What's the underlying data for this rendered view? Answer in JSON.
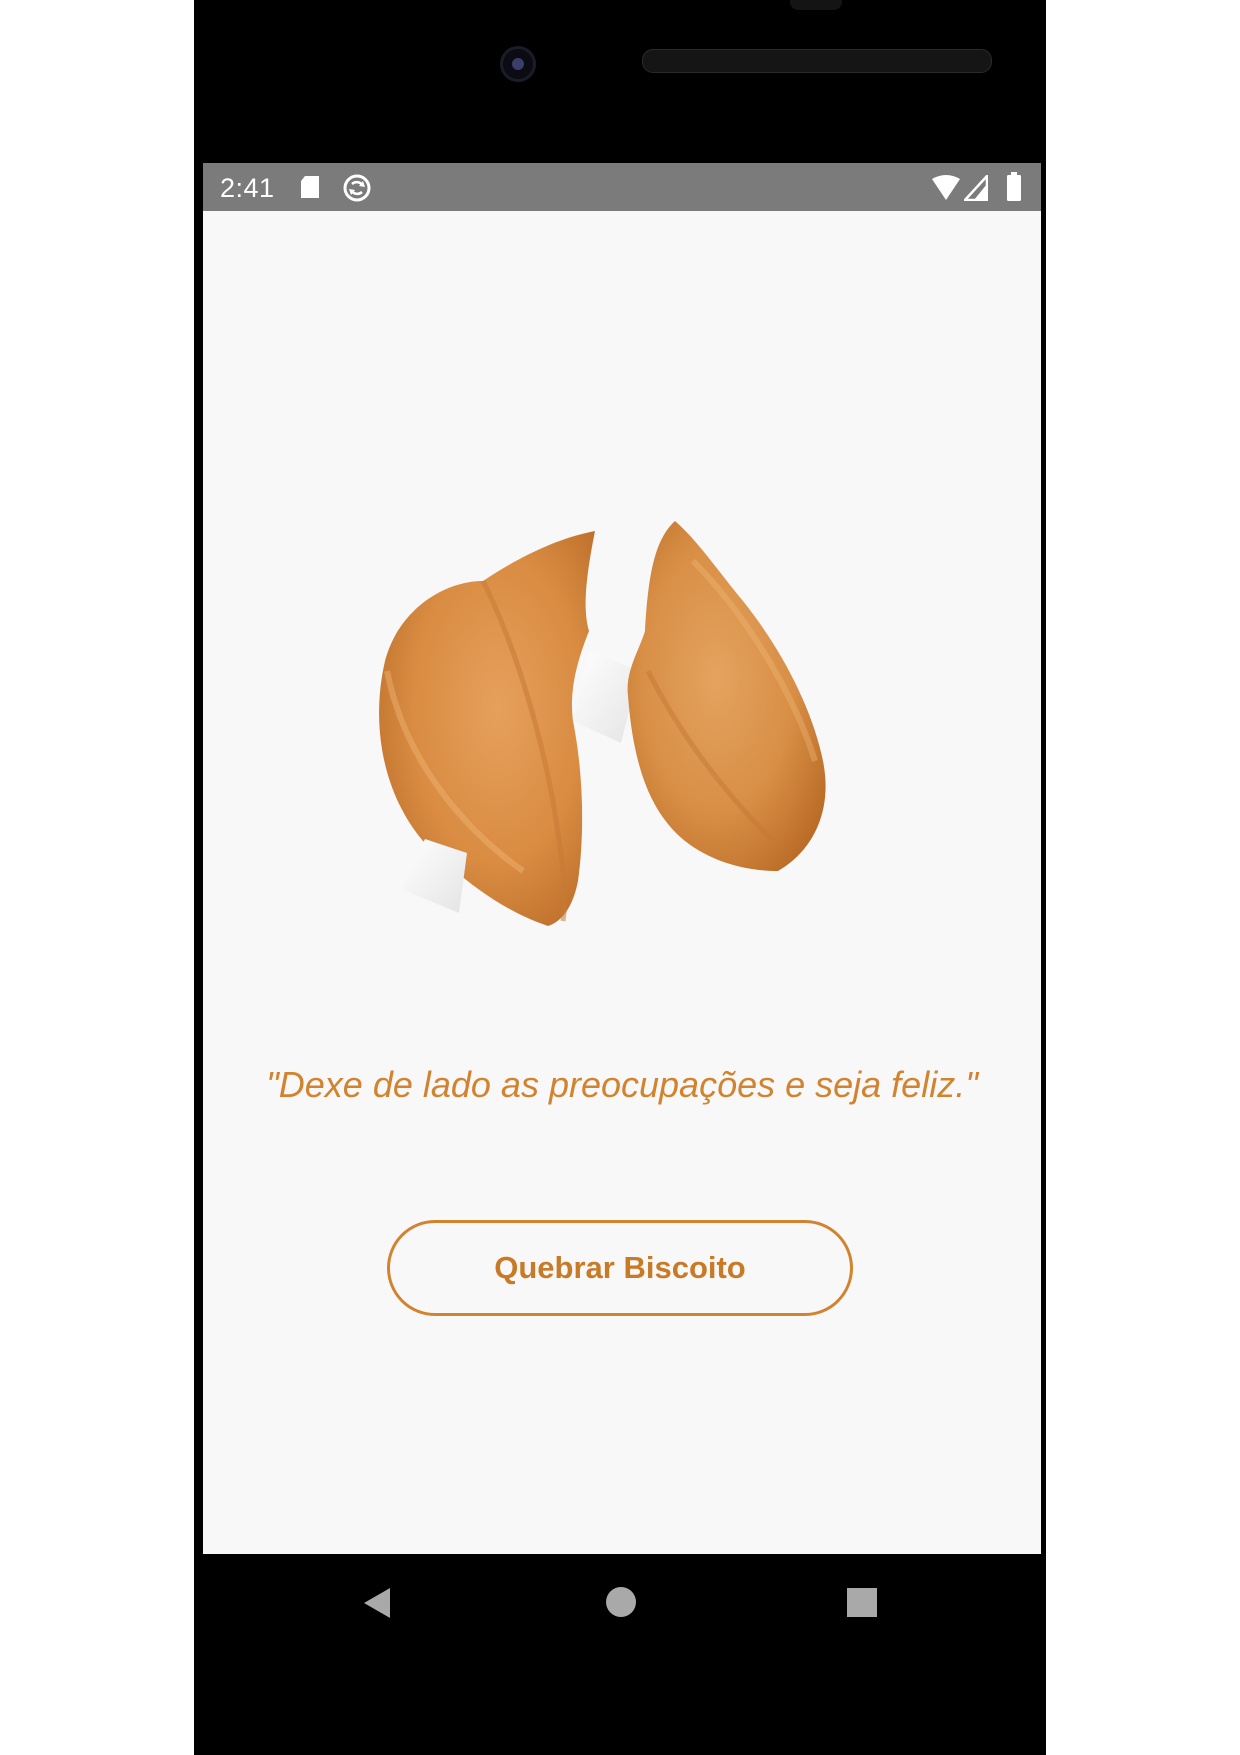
{
  "status_bar": {
    "time": "2:41",
    "left_icons": [
      "sd-card-icon",
      "sync-icon"
    ],
    "right_icons": [
      "wifi-icon",
      "signal-icon",
      "battery-icon"
    ],
    "background": "#7b7b7b"
  },
  "app": {
    "background": "#f8f8f8",
    "accent_color": "#d2832f",
    "image": "fortune-cookie-image",
    "quote": "\"Dexe de lado as preocupações e seja feliz.\"",
    "button_label": "Quebrar Biscoito"
  },
  "nav_bar": {
    "buttons": [
      "back-icon",
      "home-icon",
      "recents-icon"
    ]
  }
}
